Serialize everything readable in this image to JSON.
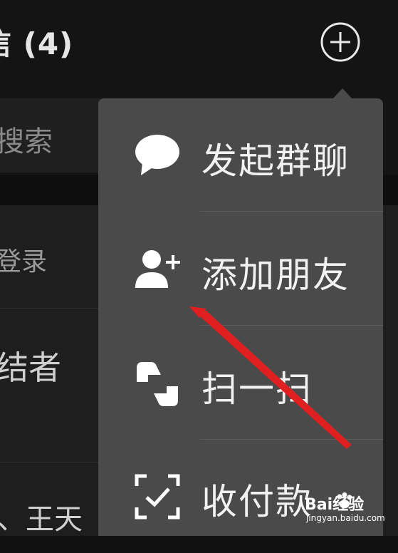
{
  "header": {
    "title": "信 (4)",
    "add_icon": "plus-circle-icon"
  },
  "search": {
    "placeholder": "搜索",
    "icon": "search-icon"
  },
  "list": {
    "items": [
      {
        "text": "登录"
      },
      {
        "text": "结者"
      },
      {
        "text": "、王天"
      }
    ]
  },
  "menu": {
    "items": [
      {
        "label": "发起群聊",
        "icon": "chat-bubble-icon"
      },
      {
        "label": "添加朋友",
        "icon": "add-friend-icon"
      },
      {
        "label": "扫一扫",
        "icon": "scan-icon"
      },
      {
        "label": "收付款",
        "icon": "payment-scan-icon"
      }
    ]
  },
  "annotation": {
    "color": "#e02020"
  },
  "watermark": {
    "brand": "Bai经验",
    "url": "jingyan.baidu.com"
  }
}
